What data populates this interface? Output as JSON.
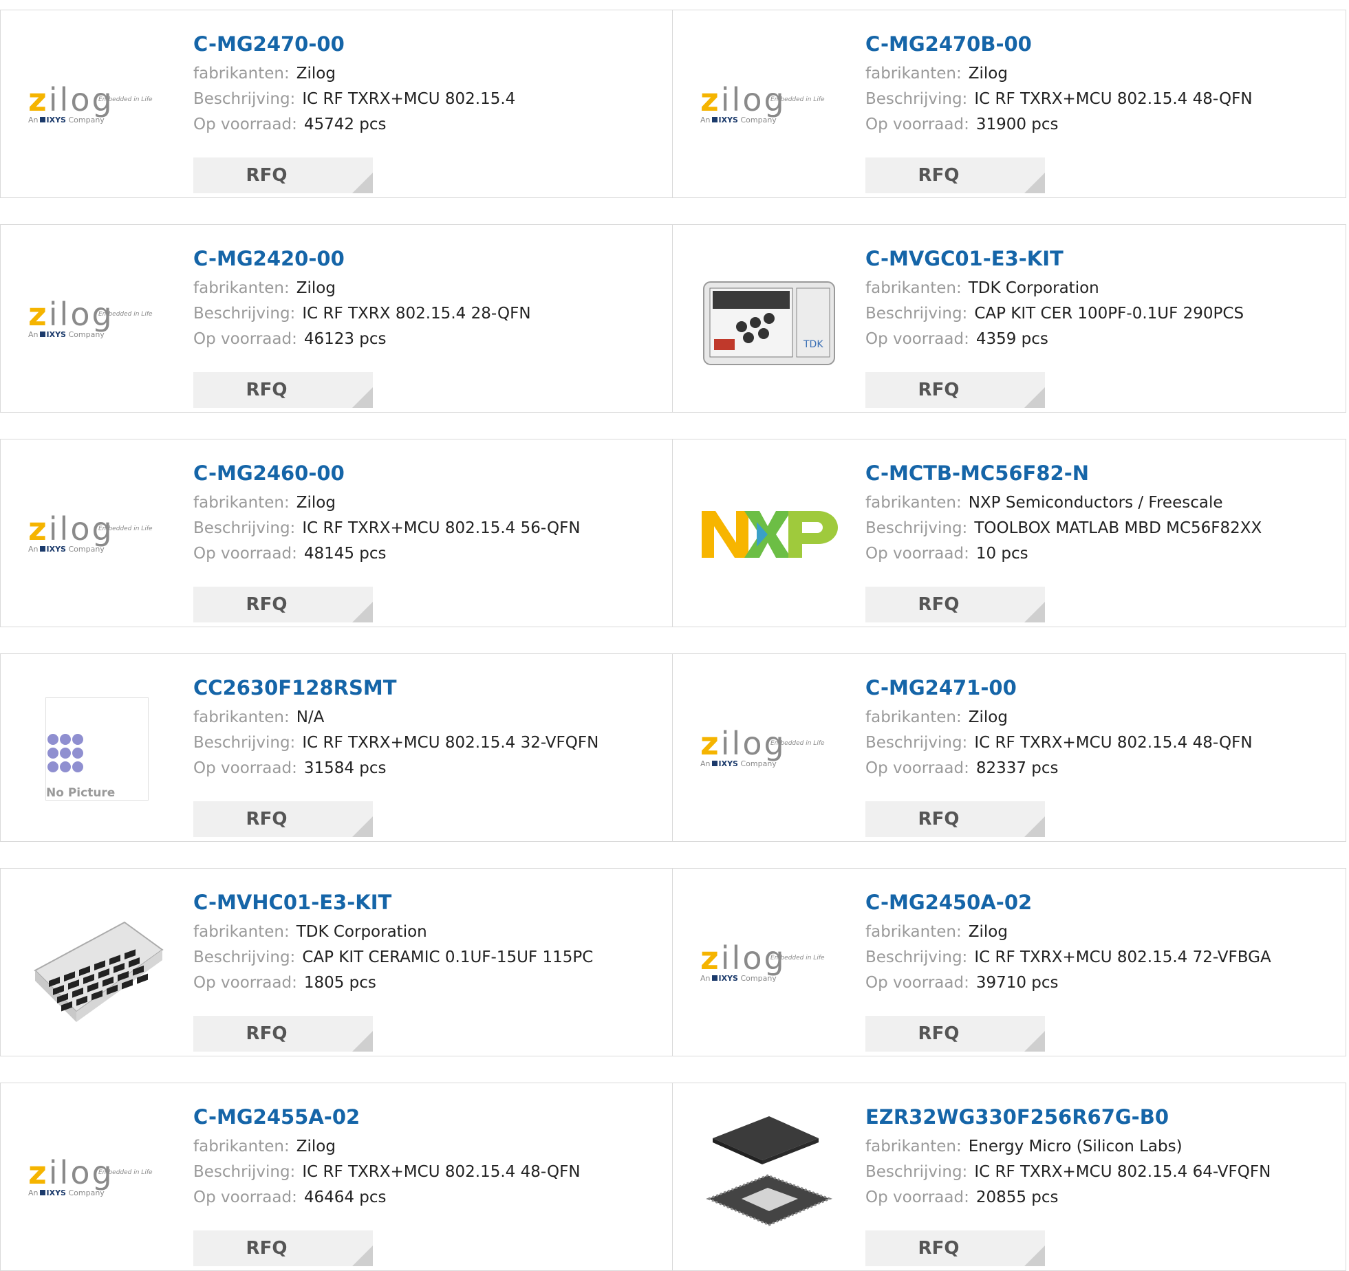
{
  "labels": {
    "manufacturer": "fabrikanten:",
    "description": "Beschrijving:",
    "stock": "Op voorraad:",
    "rfq": "RFQ"
  },
  "logos": {
    "zilog_word_z": "z",
    "zilog_word_rest": "ilog",
    "zilog_tag": "Embedded in Life",
    "zilog_sub_an": "An",
    "zilog_sub_ixys": "IXYS",
    "zilog_sub_company": "Company",
    "no_picture": "No Picture",
    "tdk_label": "TDK"
  },
  "colors": {
    "part_link": "#1565a8",
    "label_gray": "#9a9a9a",
    "rfq_bg": "#f0f0f0",
    "border": "#d9d9d9"
  },
  "products": [
    {
      "part": "C-MG2470-00",
      "manufacturer": "Zilog",
      "description": "IC RF TXRX+MCU 802.15.4",
      "stock": "45742 pcs",
      "image": "zilog-logo"
    },
    {
      "part": "C-MG2470B-00",
      "manufacturer": "Zilog",
      "description": "IC RF TXRX+MCU 802.15.4 48-QFN",
      "stock": "31900 pcs",
      "image": "zilog-logo"
    },
    {
      "part": "C-MG2420-00",
      "manufacturer": "Zilog",
      "description": "IC RF TXRX 802.15.4 28-QFN",
      "stock": "46123 pcs",
      "image": "zilog-logo"
    },
    {
      "part": "C-MVGC01-E3-KIT",
      "manufacturer": "TDK Corporation",
      "description": "CAP KIT CER 100PF-0.1UF 290PCS",
      "stock": "4359 pcs",
      "image": "tdk-kit-box"
    },
    {
      "part": "C-MG2460-00",
      "manufacturer": "Zilog",
      "description": "IC RF TXRX+MCU 802.15.4 56-QFN",
      "stock": "48145 pcs",
      "image": "zilog-logo"
    },
    {
      "part": "C-MCTB-MC56F82-N",
      "manufacturer": "NXP Semiconductors / Freescale",
      "description": "TOOLBOX MATLAB MBD MC56F82XX",
      "stock": "10 pcs",
      "image": "nxp-logo"
    },
    {
      "part": "CC2630F128RSMT",
      "manufacturer": "N/A",
      "description": "IC RF TXRX+MCU 802.15.4 32-VFQFN",
      "stock": "31584 pcs",
      "image": "no-picture"
    },
    {
      "part": "C-MG2471-00",
      "manufacturer": "Zilog",
      "description": "IC RF TXRX+MCU 802.15.4 48-QFN",
      "stock": "82337 pcs",
      "image": "zilog-logo"
    },
    {
      "part": "C-MVHC01-E3-KIT",
      "manufacturer": "TDK Corporation",
      "description": "CAP KIT CERAMIC 0.1UF-15UF 115PC",
      "stock": "1805 pcs",
      "image": "component-tray"
    },
    {
      "part": "C-MG2450A-02",
      "manufacturer": "Zilog",
      "description": "IC RF TXRX+MCU 802.15.4 72-VFBGA",
      "stock": "39710 pcs",
      "image": "zilog-logo"
    },
    {
      "part": "C-MG2455A-02",
      "manufacturer": "Zilog",
      "description": "IC RF TXRX+MCU 802.15.4 48-QFN",
      "stock": "46464 pcs",
      "image": "zilog-logo"
    },
    {
      "part": "EZR32WG330F256R67G-B0",
      "manufacturer": "Energy Micro (Silicon Labs)",
      "description": "IC RF TXRX+MCU 802.15.4 64-VFQFN",
      "stock": "20855 pcs",
      "image": "qfn-chip"
    }
  ]
}
